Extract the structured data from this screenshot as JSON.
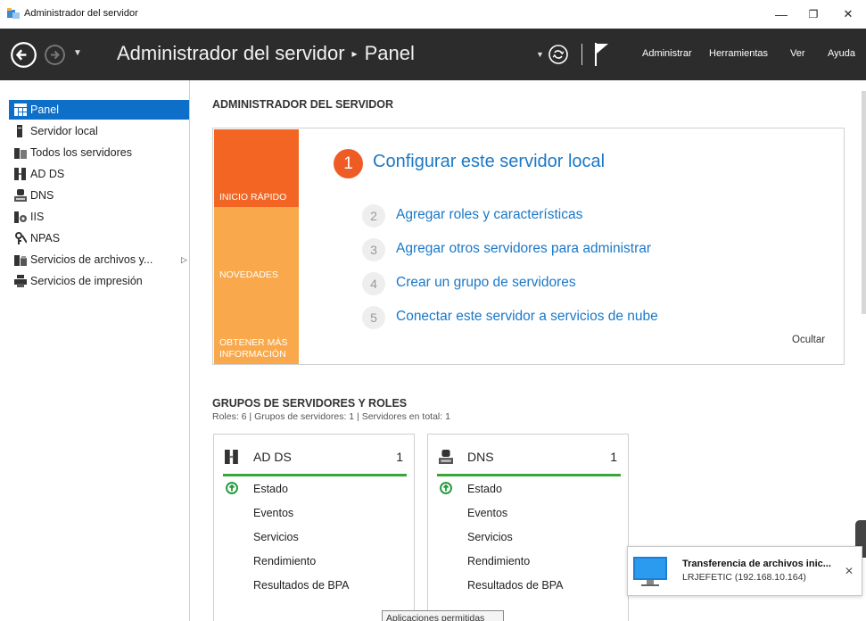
{
  "window": {
    "title": "Administrador del servidor",
    "minimize_glyph": "—",
    "restore_glyph": "❐",
    "close_glyph": "✕"
  },
  "header": {
    "app_name": "Administrador del servidor",
    "separator": "▸",
    "current_page": "Panel",
    "menus": [
      "Administrar",
      "Herramientas",
      "Ver",
      "Ayuda"
    ]
  },
  "sidebar": {
    "items": [
      {
        "label": "Panel",
        "icon": "dashboard-icon",
        "active": true
      },
      {
        "label": "Servidor local",
        "icon": "server-icon"
      },
      {
        "label": "Todos los servidores",
        "icon": "servers-icon"
      },
      {
        "label": "AD DS",
        "icon": "directory-icon"
      },
      {
        "label": "DNS",
        "icon": "dns-icon"
      },
      {
        "label": "IIS",
        "icon": "iis-icon"
      },
      {
        "label": "NPAS",
        "icon": "npas-icon"
      },
      {
        "label": "Servicios de archivos y...",
        "icon": "file-services-icon",
        "has_submenu": true
      },
      {
        "label": "Servicios de impresión",
        "icon": "printer-icon"
      }
    ]
  },
  "main": {
    "title": "ADMINISTRADOR DEL SERVIDOR",
    "quick_start": {
      "tiles": [
        "INICIO RÁPIDO",
        "NOVEDADES",
        "OBTENER MÁS INFORMACIÓN"
      ],
      "tile_colors": [
        "#f26522",
        "#f9a94b",
        "#f9a94b"
      ],
      "primary_step": {
        "number": "1",
        "label": "Configurar este servidor local"
      },
      "steps": [
        {
          "number": "2",
          "label": "Agregar roles y características"
        },
        {
          "number": "3",
          "label": "Agregar otros servidores para administrar"
        },
        {
          "number": "4",
          "label": "Crear un grupo de servidores"
        },
        {
          "number": "5",
          "label": "Conectar este servidor a servicios de nube"
        }
      ],
      "hide_label": "Ocultar"
    },
    "groups": {
      "title": "GRUPOS DE SERVIDORES Y ROLES",
      "summary": "Roles: 6   |   Grupos de servidores: 1   |   Servidores en total: 1",
      "cards": [
        {
          "name": "AD DS",
          "count": "1",
          "icon": "directory-icon",
          "rows": [
            "Estado",
            "Eventos",
            "Servicios",
            "Rendimiento",
            "Resultados de BPA"
          ]
        },
        {
          "name": "DNS",
          "count": "1",
          "icon": "dns-icon",
          "rows": [
            "Estado",
            "Eventos",
            "Servicios",
            "Rendimiento",
            "Resultados de BPA"
          ]
        }
      ]
    },
    "tooltip": "Aplicaciones permitidas"
  },
  "toast": {
    "title": "Transferencia de archivos inic...",
    "subtitle": "LRJEFETIC (192.168.10.164)",
    "close_glyph": "✕"
  },
  "colors": {
    "accent": "#0d6fc8",
    "link": "#1b78c6",
    "header_bg": "#2c2c2c",
    "status_ok": "#3aa63a"
  }
}
